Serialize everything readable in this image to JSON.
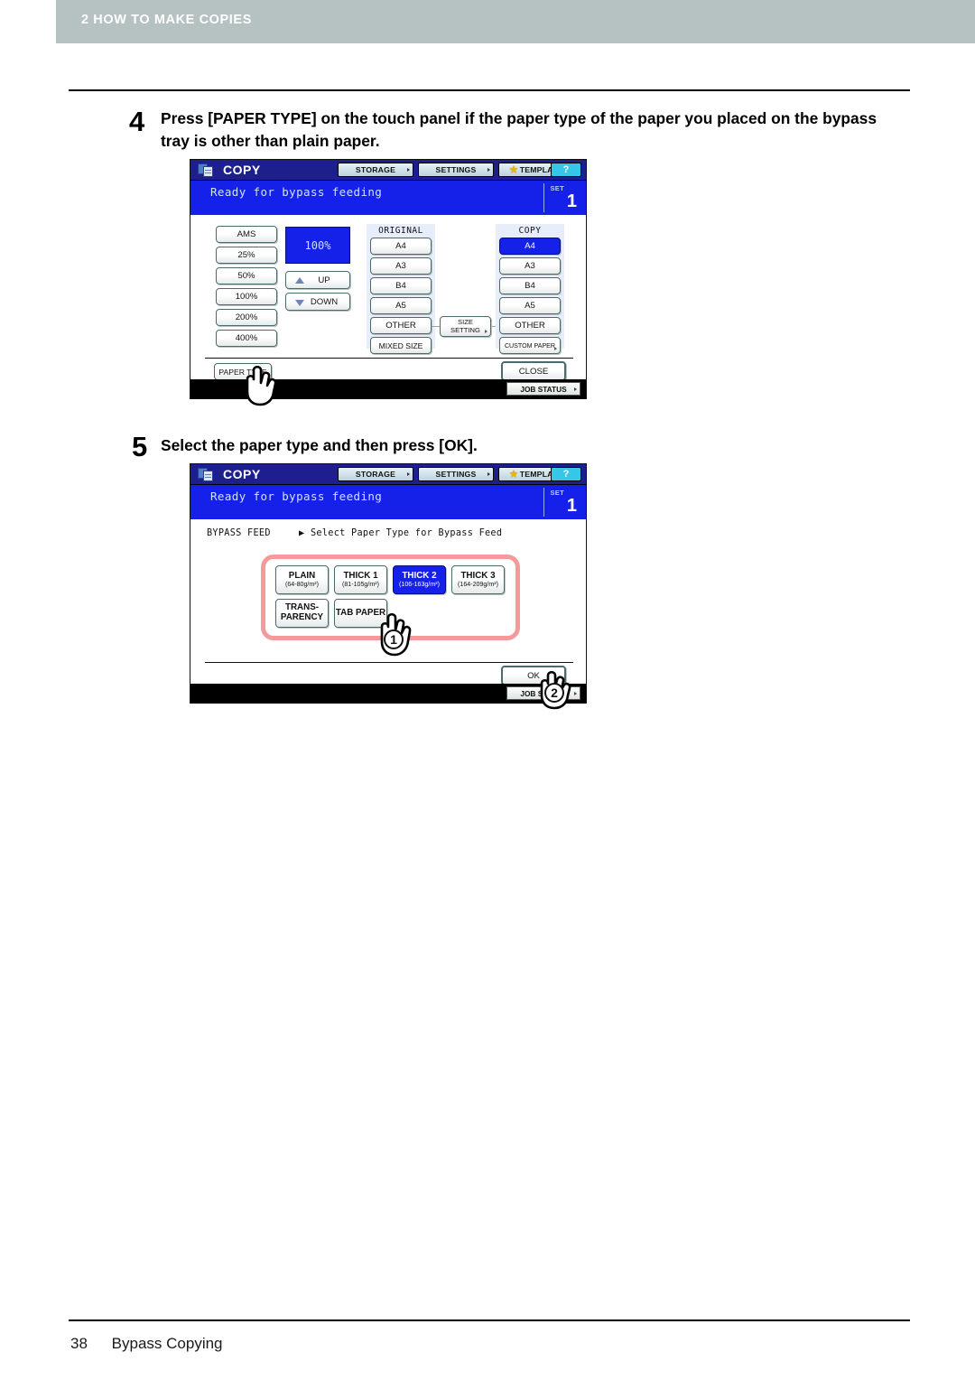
{
  "page": {
    "chapter_header": "2 HOW TO MAKE COPIES",
    "footer_page_number": "38",
    "footer_section": "Bypass Copying"
  },
  "steps": [
    {
      "number": "4",
      "text": "Press [PAPER TYPE] on the touch panel if the paper type of the paper you placed on the bypass tray is other than plain paper."
    },
    {
      "number": "5",
      "text": "Select the paper type and then press [OK]."
    }
  ],
  "panel_common": {
    "title": "COPY",
    "copy_icon": "copy-pages-icon",
    "top_buttons": [
      {
        "label": "STORAGE",
        "icon": "chevron-right-icon"
      },
      {
        "label": "SETTINGS",
        "icon": "chevron-right-icon"
      },
      {
        "label": "TEMPLATE",
        "icon": "star-icon"
      }
    ],
    "help_button": "?",
    "status_message": "Ready for bypass feeding",
    "set_label": "SET",
    "set_count": "1",
    "job_status": "JOB STATUS",
    "colors": {
      "title_bar": "#1d1f8f",
      "status_bar": "#1520e8",
      "selected": "#1520e8",
      "highlight_frame": "#f49a9a",
      "help": "#35c6e8"
    }
  },
  "panel_zoom": {
    "ratio_buttons": [
      "AMS",
      "25%",
      "50%",
      "100%",
      "200%",
      "400%"
    ],
    "zoom_value": "100%",
    "up_label": "UP",
    "down_label": "DOWN",
    "original": {
      "heading": "ORIGINAL",
      "sizes": [
        "A4",
        "A3",
        "B4",
        "A5",
        "OTHER",
        "MIXED SIZE"
      ],
      "selected": ""
    },
    "copy": {
      "heading": "COPY",
      "sizes": [
        "A4",
        "A3",
        "B4",
        "A5",
        "OTHER",
        "CUSTOM PAPER"
      ],
      "selected": "A4"
    },
    "size_setting": "SIZE SETTING",
    "paper_type_button": "PAPER TYPE",
    "close_button": "CLOSE"
  },
  "panel_paper_type": {
    "breadcrumb_root": "BYPASS FEED",
    "breadcrumb_current": "Select Paper Type for Bypass Feed",
    "paper_types": [
      {
        "name": "PLAIN",
        "weight": "(64-80g/m²)",
        "selected": false
      },
      {
        "name": "THICK 1",
        "weight": "(81-105g/m²)",
        "selected": false
      },
      {
        "name": "THICK 2",
        "weight": "(106-163g/m²)",
        "selected": true
      },
      {
        "name": "THICK 3",
        "weight": "(164-209g/m²)",
        "selected": false
      },
      {
        "name": "TRANS-\nPARENCY",
        "weight": "",
        "selected": false
      },
      {
        "name": "TAB PAPER",
        "weight": "",
        "selected": false
      }
    ],
    "ok_button": "OK",
    "callouts": [
      "1",
      "2"
    ]
  }
}
